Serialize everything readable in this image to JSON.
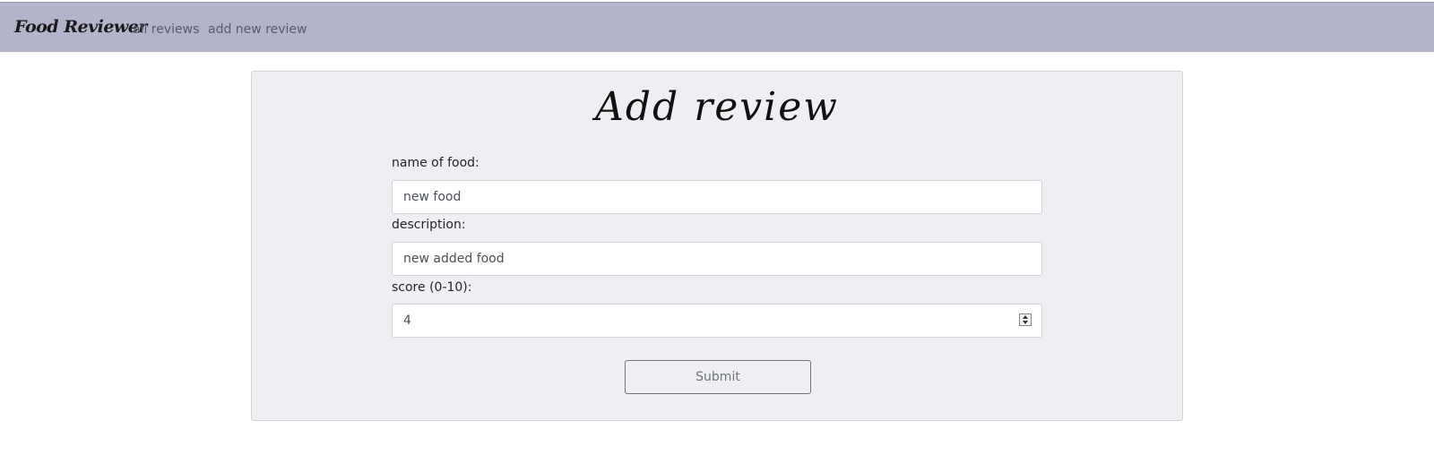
{
  "nav": {
    "brand": "Food Reviewer",
    "links": [
      "all reviews",
      "add new review"
    ]
  },
  "form": {
    "title": "Add review",
    "name_label": "name of food:",
    "name_value": "new food",
    "description_label": "description:",
    "description_value": "new added food",
    "score_label": "score (0-10):",
    "score_value": "4",
    "submit_label": "Submit"
  },
  "colors": {
    "navbar": "#b3b3cc",
    "card_background": "#efeff3",
    "button_border": "#6c757d"
  }
}
